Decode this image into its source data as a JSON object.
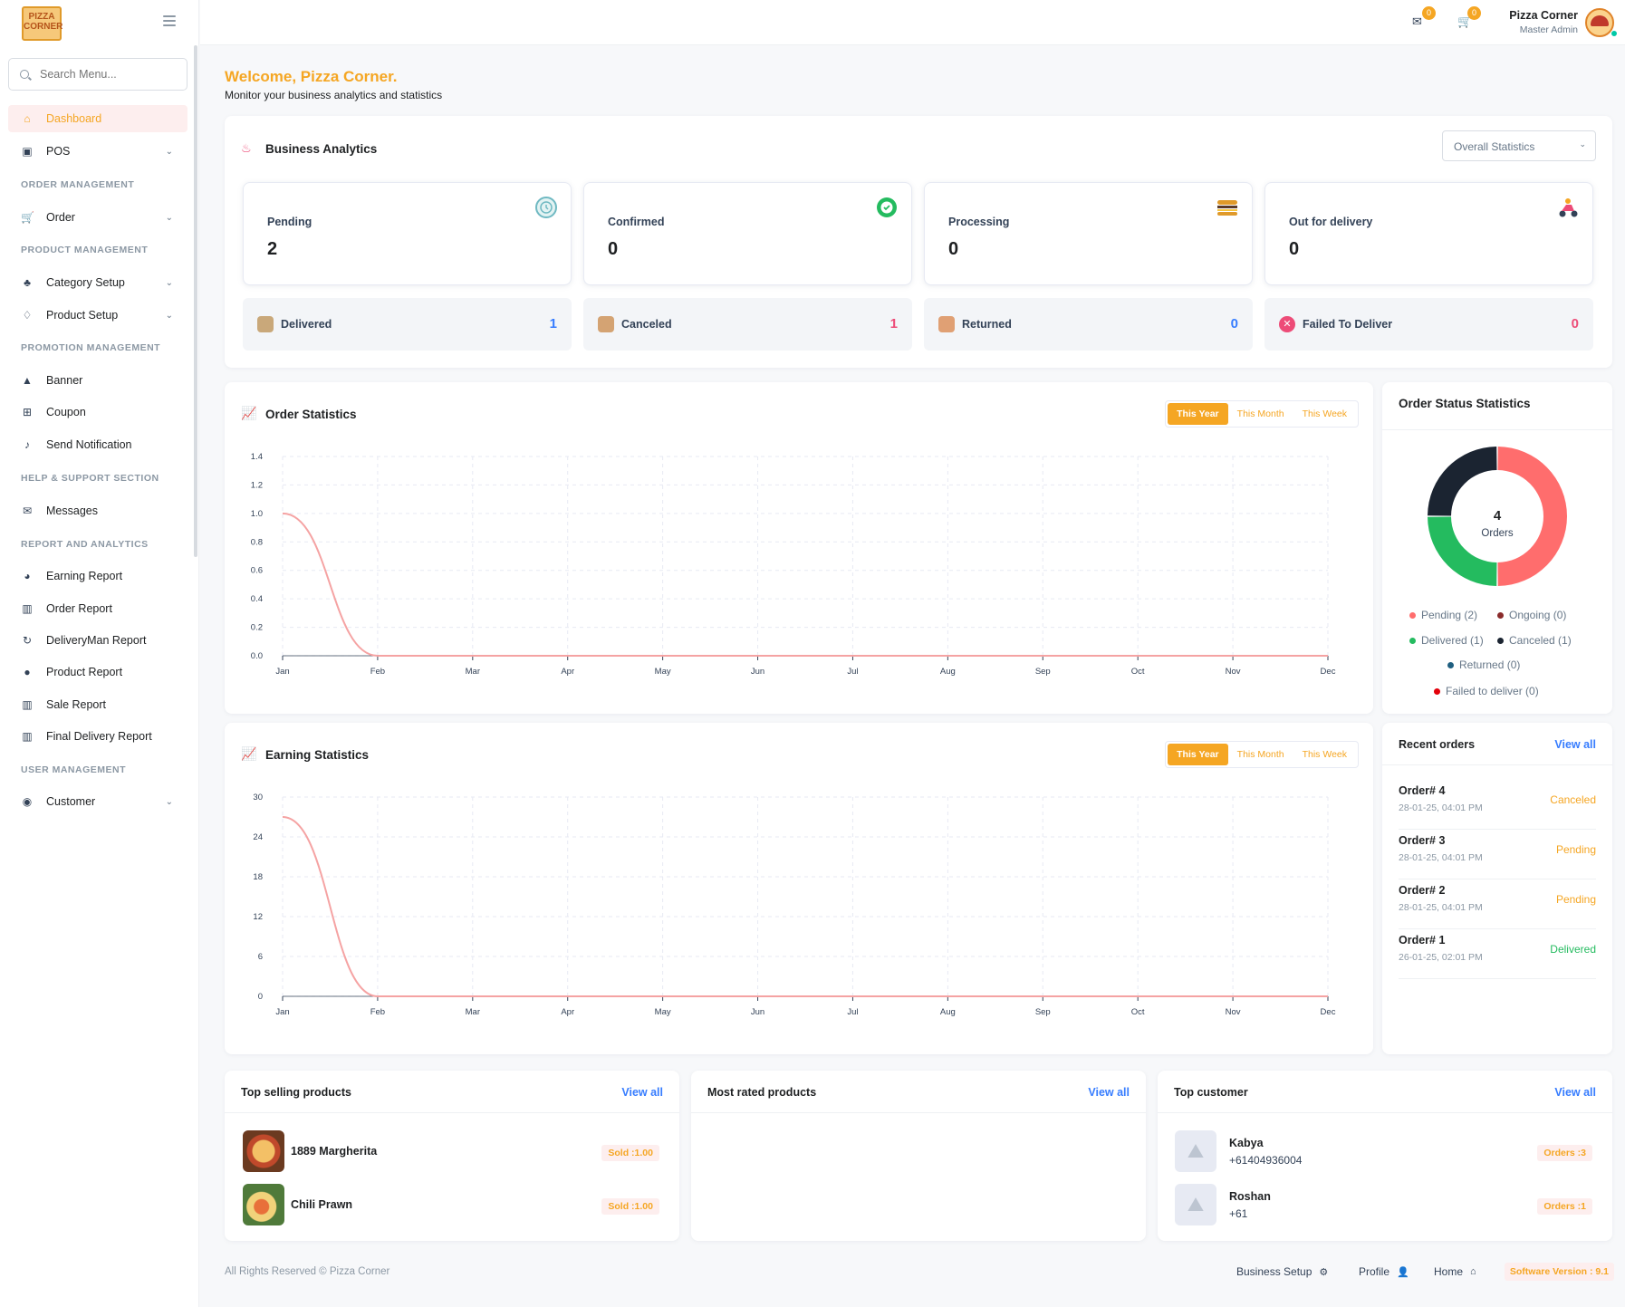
{
  "sidebar": {
    "logo_text": "PIZZA CORNER",
    "search_placeholder": "Search Menu...",
    "items": [
      {
        "label": "Dashboard",
        "icon": "home-icon"
      },
      {
        "label": "POS",
        "icon": "shopping-bag-icon"
      },
      {
        "label": "Order",
        "icon": "cart-icon"
      },
      {
        "label": "Category Setup",
        "icon": "category-icon"
      },
      {
        "label": "Product Setup",
        "icon": "tag-icon"
      },
      {
        "label": "Banner",
        "icon": "image-icon"
      },
      {
        "label": "Coupon",
        "icon": "gift-icon"
      },
      {
        "label": "Send Notification",
        "icon": "bell-icon"
      },
      {
        "label": "Messages",
        "icon": "mail-icon"
      },
      {
        "label": "Earning Report",
        "icon": "pie-icon"
      },
      {
        "label": "Order Report",
        "icon": "bar-chart-icon"
      },
      {
        "label": "DeliveryMan Report",
        "icon": "refresh-icon"
      },
      {
        "label": "Product Report",
        "icon": "product-icon"
      },
      {
        "label": "Sale Report",
        "icon": "bar-chart-icon"
      },
      {
        "label": "Final Delivery Report",
        "icon": "bar-chart-icon"
      },
      {
        "label": "Customer",
        "icon": "user-icon"
      }
    ],
    "headers": [
      "ORDER MANAGEMENT",
      "PRODUCT MANAGEMENT",
      "PROMOTION MANAGEMENT",
      "HELP & SUPPORT SECTION",
      "REPORT AND ANALYTICS",
      "USER MANAGEMENT"
    ]
  },
  "topbar": {
    "messages_count": "0",
    "cart_count": "0",
    "user_name": "Pizza Corner",
    "user_role": "Master Admin"
  },
  "welcome": {
    "title": "Welcome, Pizza Corner.",
    "subtitle": "Monitor your business analytics and statistics"
  },
  "business_analytics": {
    "title": "Business Analytics",
    "select_value": "Overall Statistics",
    "stats": [
      {
        "label": "Pending",
        "value": "2"
      },
      {
        "label": "Confirmed",
        "value": "0"
      },
      {
        "label": "Processing",
        "value": "0"
      },
      {
        "label": "Out for delivery",
        "value": "0"
      }
    ],
    "mini": [
      {
        "label": "Delivered",
        "value": "1",
        "color": "#377dff"
      },
      {
        "label": "Canceled",
        "value": "1",
        "color": "#ed4c78"
      },
      {
        "label": "Returned",
        "value": "0",
        "color": "#377dff"
      },
      {
        "label": "Failed To Deliver",
        "value": "0",
        "color": "#ed4c78"
      }
    ]
  },
  "tabs": [
    "This Year",
    "This Month",
    "This Week"
  ],
  "order_statistics": {
    "title": "Order Statistics"
  },
  "earning_statistics": {
    "title": "Earning Statistics"
  },
  "chart_data": [
    {
      "type": "line",
      "title": "Order Statistics",
      "x": [
        "Jan",
        "Feb",
        "Mar",
        "Apr",
        "May",
        "Jun",
        "Jul",
        "Aug",
        "Sep",
        "Oct",
        "Nov",
        "Dec"
      ],
      "series": [
        {
          "values": [
            1,
            0,
            0,
            0,
            0,
            0,
            0,
            0,
            0,
            0,
            0,
            0
          ],
          "color": "#f5a3a3"
        }
      ],
      "yticks": [
        "0.0",
        "0.2",
        "0.4",
        "0.6",
        "0.8",
        "1.0",
        "1.2",
        "1.4"
      ],
      "ylim": [
        0,
        1.4
      ],
      "grid": true
    },
    {
      "type": "line",
      "title": "Earning Statistics",
      "x": [
        "Jan",
        "Feb",
        "Mar",
        "Apr",
        "May",
        "Jun",
        "Jul",
        "Aug",
        "Sep",
        "Oct",
        "Nov",
        "Dec"
      ],
      "series": [
        {
          "values": [
            27,
            0,
            0,
            0,
            0,
            0,
            0,
            0,
            0,
            0,
            0,
            0
          ],
          "color": "#f5a3a3"
        }
      ],
      "yticks": [
        "0",
        "6",
        "12",
        "18",
        "24",
        "30"
      ],
      "ylim": [
        0,
        30
      ],
      "grid": true
    },
    {
      "type": "pie",
      "title": "Order Status Statistics",
      "center_value": "4",
      "center_label": "Orders",
      "slices": [
        {
          "label": "Pending",
          "value": 2,
          "color": "#ff6d6d"
        },
        {
          "label": "Delivered",
          "value": 1,
          "color": "#24bb5f"
        },
        {
          "label": "Canceled",
          "value": 1,
          "color": "#1b2431"
        }
      ],
      "legend": [
        {
          "text": "Pending (2)",
          "color": "#ff6d6d"
        },
        {
          "text": "Ongoing (0)",
          "color": "#8a2b2b"
        },
        {
          "text": "Delivered (1)",
          "color": "#24bb5f"
        },
        {
          "text": "Canceled (1)",
          "color": "#1b2431"
        },
        {
          "text": "Returned (0)",
          "color": "#1f5f80"
        },
        {
          "text": "Failed to deliver (0)",
          "color": "#e3000b"
        }
      ]
    }
  ],
  "order_status": {
    "title": "Order Status Statistics"
  },
  "recent_orders": {
    "title": "Recent orders",
    "view_all": "View all",
    "items": [
      {
        "order": "Order# 4",
        "date": "28-01-25, 04:01 PM",
        "status": "Canceled",
        "color": "#f5a623"
      },
      {
        "order": "Order# 3",
        "date": "28-01-25, 04:01 PM",
        "status": "Pending",
        "color": "#f5a623"
      },
      {
        "order": "Order# 2",
        "date": "28-01-25, 04:01 PM",
        "status": "Pending",
        "color": "#f5a623"
      },
      {
        "order": "Order# 1",
        "date": "26-01-25, 02:01 PM",
        "status": "Delivered",
        "color": "#24bb5f"
      }
    ]
  },
  "top_selling": {
    "title": "Top selling products",
    "view_all": "View all",
    "items": [
      {
        "name": "1889 Margherita",
        "sold": "Sold :1.00"
      },
      {
        "name": "Chili Prawn",
        "sold": "Sold :1.00"
      }
    ]
  },
  "most_rated": {
    "title": "Most rated products",
    "view_all": "View all"
  },
  "top_customer": {
    "title": "Top customer",
    "view_all": "View all",
    "items": [
      {
        "name": "Kabya",
        "phone": "+61404936004",
        "orders": "Orders :3"
      },
      {
        "name": "Roshan",
        "phone": "+61",
        "orders": "Orders :1"
      }
    ]
  },
  "footer": {
    "copyright": "All Rights Reserved © Pizza Corner",
    "business_setup": "Business Setup",
    "profile": "Profile",
    "home": "Home",
    "version": "Software Version : 9.1"
  }
}
